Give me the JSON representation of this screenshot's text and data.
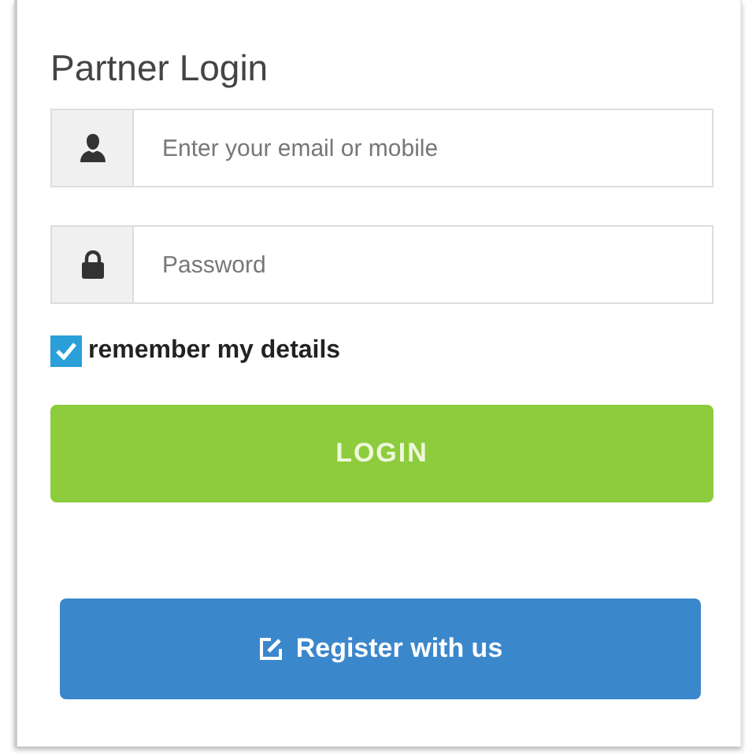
{
  "title": "Partner Login",
  "fields": [
    {
      "kind": "user",
      "placeholder": "Enter your email or mobile"
    },
    {
      "kind": "password",
      "placeholder": "Password"
    }
  ],
  "remember": {
    "label": "remember my details",
    "checked": true
  },
  "login_button": "LOGIN",
  "register_button": "Register with us"
}
